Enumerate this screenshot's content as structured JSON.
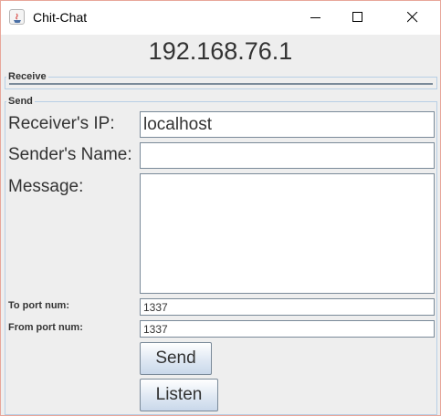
{
  "window": {
    "title": "Chit-Chat"
  },
  "header": {
    "ip": "192.168.76.1"
  },
  "receive": {
    "label": "Receive"
  },
  "send": {
    "label": "Send",
    "receiver_ip_label": "Receiver's IP:",
    "receiver_ip_value": "localhost",
    "sender_name_label": "Sender's Name:",
    "sender_name_value": "",
    "message_label": "Message:",
    "message_value": "",
    "to_port_label": "To port num:",
    "to_port_value": "1337",
    "from_port_label": "From port num:",
    "from_port_value": "1337",
    "send_button": "Send",
    "listen_button": "Listen"
  }
}
